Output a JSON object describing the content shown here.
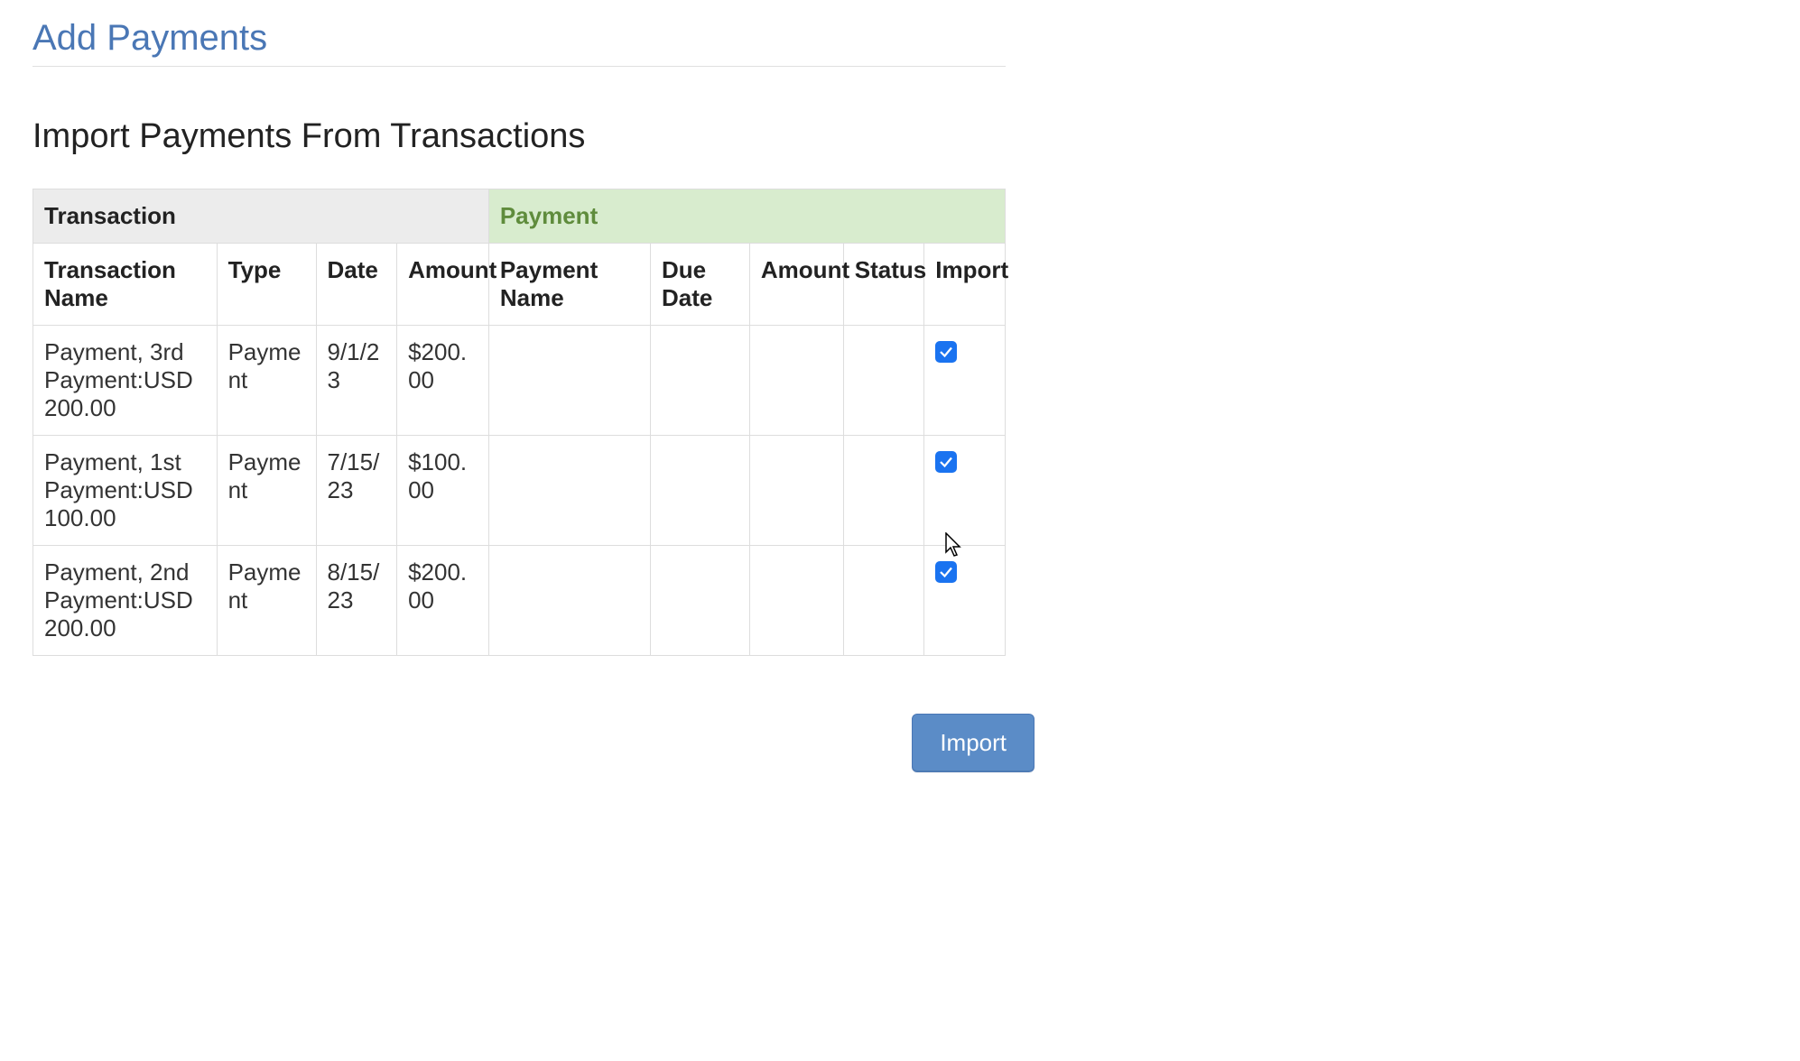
{
  "page_title": "Add Payments",
  "section_title": "Import Payments From Transactions",
  "group_headers": {
    "transaction": "Transaction",
    "payment": "Payment"
  },
  "columns": {
    "transaction_name": "Transaction Name",
    "type": "Type",
    "date": "Date",
    "amount": "Amount",
    "payment_name": "Payment Name",
    "due_date": "Due Date",
    "payment_amount": "Amount",
    "status": "Status",
    "import": "Import"
  },
  "rows": [
    {
      "transaction_name": "Payment, 3rd Payment:USD 200.00",
      "type": "Payment",
      "date": "9/1/23",
      "amount": "$200.00",
      "payment_name": "",
      "due_date": "",
      "payment_amount": "",
      "status": "",
      "import_checked": true
    },
    {
      "transaction_name": "Payment, 1st Payment:USD 100.00",
      "type": "Payment",
      "date": "7/15/23",
      "amount": "$100.00",
      "payment_name": "",
      "due_date": "",
      "payment_amount": "",
      "status": "",
      "import_checked": true
    },
    {
      "transaction_name": "Payment, 2nd Payment:USD 200.00",
      "type": "Payment",
      "date": "8/15/23",
      "amount": "$200.00",
      "payment_name": "",
      "due_date": "",
      "payment_amount": "",
      "status": "",
      "import_checked": true
    }
  ],
  "buttons": {
    "import": "Import"
  },
  "icons": {
    "checkbox_checked": "checkbox-checked-icon",
    "cursor": "cursor-arrow-icon"
  },
  "colors": {
    "title": "#4a77b5",
    "payment_group_bg": "#d8ecce",
    "payment_group_fg": "#5f8c3c",
    "transaction_group_bg": "#ececec",
    "checkbox": "#1a73f0",
    "button_bg": "#5b8cc7"
  }
}
